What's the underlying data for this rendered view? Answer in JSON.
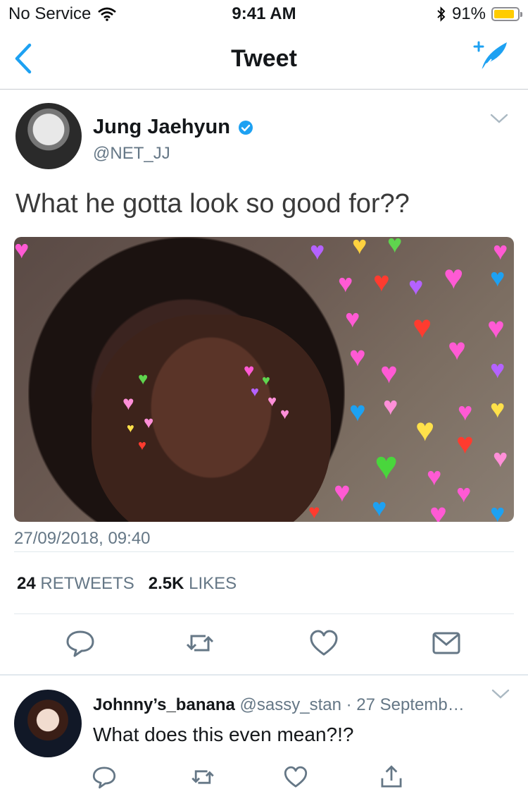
{
  "status_bar": {
    "carrier": "No Service",
    "time": "9:41 AM",
    "battery": "91%",
    "battery_level": 0.91
  },
  "nav": {
    "title": "Tweet"
  },
  "tweet": {
    "author_name": "Jung Jaehyun",
    "author_handle": "@NET_JJ",
    "text": "What he gotta look so good for??",
    "timestamp": "27/09/2018, 09:40",
    "retweets_count": "24",
    "retweets_label": "RETWEETS",
    "likes_count": "2.5K",
    "likes_label": "LIKES"
  },
  "reply": {
    "author_name": "Johnny’s_banana",
    "author_handle": "@sassy_stan",
    "date": "27 Septemb…",
    "text": "What does this even mean?!?"
  },
  "colors": {
    "accent": "#1da1f2",
    "icon": "#657786",
    "secondary_text": "#657786",
    "battery": "#ffcc00"
  }
}
